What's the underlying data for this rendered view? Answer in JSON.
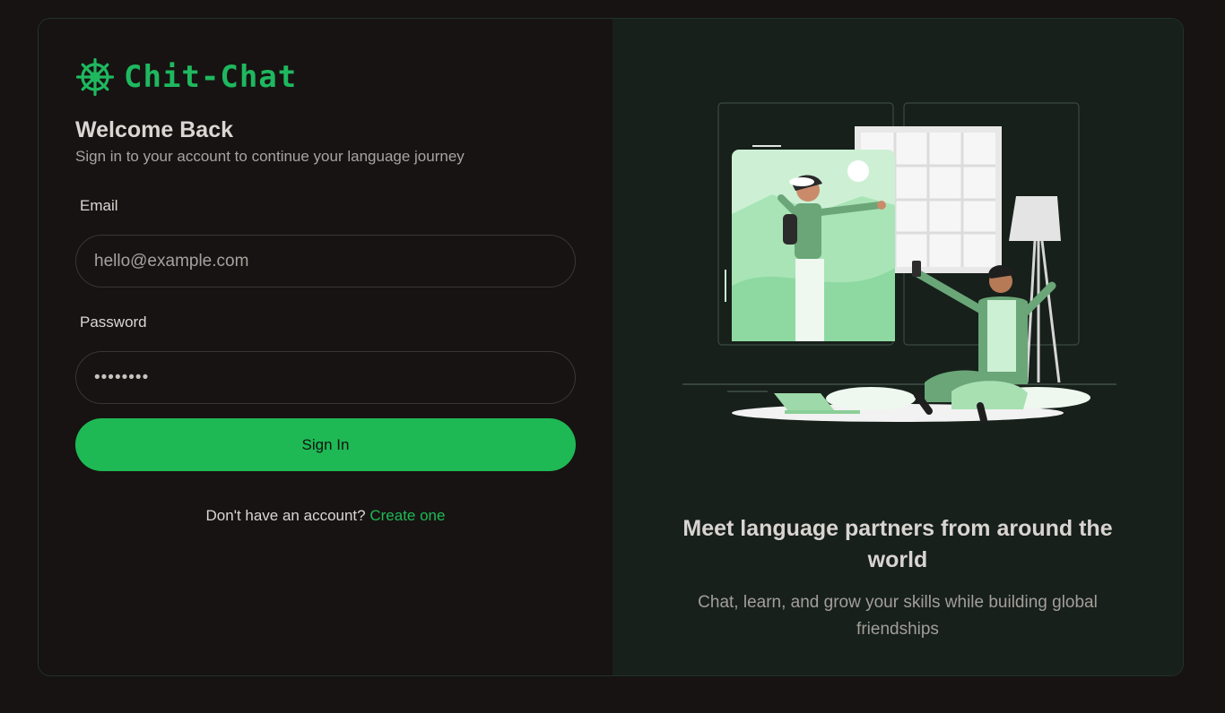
{
  "app": {
    "name": "Chit-Chat",
    "accent": "#1eb955"
  },
  "login": {
    "heading": "Welcome Back",
    "subheading": "Sign in to your account to continue your language journey",
    "email_label": "Email",
    "email_placeholder": "hello@example.com",
    "password_label": "Password",
    "password_value": "••••••••",
    "submit_label": "Sign In",
    "signup_prompt": "Don't have an account?",
    "signup_link": "Create one"
  },
  "promo": {
    "title": "Meet language partners from around the world",
    "subtitle": "Chat, learn, and grow your skills while building global friendships",
    "illustration": "video-call-illustration"
  },
  "icons": {
    "logo": "ship-wheel-icon"
  }
}
